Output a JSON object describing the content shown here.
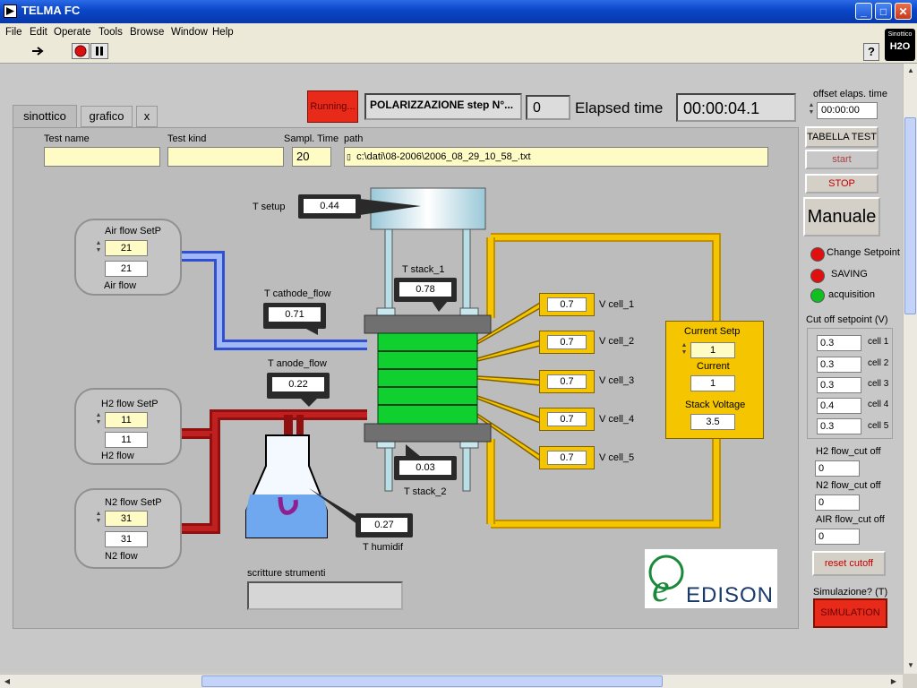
{
  "window": {
    "title": "TELMA FC",
    "minimize": "_",
    "maximize": "□",
    "close": "✕"
  },
  "menu": [
    "File",
    "Edit",
    "Operate",
    "Tools",
    "Browse",
    "Window",
    "Help"
  ],
  "logo_corner": {
    "line1": "Sinottico",
    "line2": "H2O"
  },
  "tabs": [
    "sinottico",
    "grafico",
    "x"
  ],
  "status": {
    "running": "Running...",
    "step_label": "POLARIZZAZIONE step N°...",
    "step_value": "0",
    "elapsed_label": "Elapsed time",
    "elapsed_value": "00:00:04.1"
  },
  "offset": {
    "label": "offset elaps. time",
    "value": "00:00:00"
  },
  "test": {
    "name_label": "Test name",
    "name_value": "",
    "kind_label": "Test kind",
    "kind_value": "",
    "sampl_label": "Sampl. Time",
    "sampl_value": "20",
    "path_label": "path",
    "path_value": "c:\\dati\\08-2006\\2006_08_29_10_58_.txt"
  },
  "sensors": {
    "t_setup": {
      "label": "T setup",
      "value": "0.44"
    },
    "t_stack_1": {
      "label": "T stack_1",
      "value": "0.78"
    },
    "t_cathode": {
      "label": "T cathode_flow",
      "value": "0.71"
    },
    "t_anode": {
      "label": "T anode_flow",
      "value": "0.22"
    },
    "t_stack_2": {
      "label": "T stack_2",
      "value": "0.03"
    },
    "t_humidif": {
      "label": "T humidif",
      "value": "0.27"
    }
  },
  "flows": {
    "air": {
      "setp_label": "Air flow SetP",
      "setp": "21",
      "value": "21",
      "label": "Air flow"
    },
    "h2": {
      "setp_label": "H2 flow SetP",
      "setp": "11",
      "value": "11",
      "label": "H2 flow"
    },
    "n2": {
      "setp_label": "N2 flow SetP",
      "setp": "31",
      "value": "31",
      "label": "N2 flow"
    }
  },
  "cells": [
    {
      "label": "V cell_1",
      "value": "0.7"
    },
    {
      "label": "V cell_2",
      "value": "0.7"
    },
    {
      "label": "V cell_3",
      "value": "0.7"
    },
    {
      "label": "V cell_4",
      "value": "0.7"
    },
    {
      "label": "V cell_5",
      "value": "0.7"
    }
  ],
  "load": {
    "setp_label": "Current Setp",
    "setp": "1",
    "current_label": "Current",
    "current": "1",
    "voltage_label": "Stack Voltage",
    "voltage": "3.5"
  },
  "scritture": {
    "label": "scritture strumenti",
    "value": ""
  },
  "brand": "EDISON",
  "side": {
    "tabella": "TABELLA TEST",
    "start": "start",
    "stop": "STOP",
    "manuale": "Manuale",
    "leds": [
      {
        "label": "Change Setpoint",
        "color": "#e01010"
      },
      {
        "label": "SAVING",
        "color": "#e01010"
      },
      {
        "label": "acquisition",
        "color": "#10c020"
      }
    ],
    "cutoff_title": "Cut off setpoint (V)",
    "cutoffs": [
      {
        "label": "cell 1",
        "value": "0.3"
      },
      {
        "label": "cell 2",
        "value": "0.3"
      },
      {
        "label": "cell 3",
        "value": "0.3"
      },
      {
        "label": "cell 4",
        "value": "0.4"
      },
      {
        "label": "cell 5",
        "value": "0.3"
      }
    ],
    "h2_cut": {
      "label": "H2 flow_cut off",
      "value": "0"
    },
    "n2_cut": {
      "label": "N2 flow_cut off",
      "value": "0"
    },
    "air_cut": {
      "label": "AIR flow_cut off",
      "value": "0"
    },
    "reset": "reset cutoff",
    "sim_label": "Simulazione? (T)",
    "sim_button": "SIMULATION"
  }
}
